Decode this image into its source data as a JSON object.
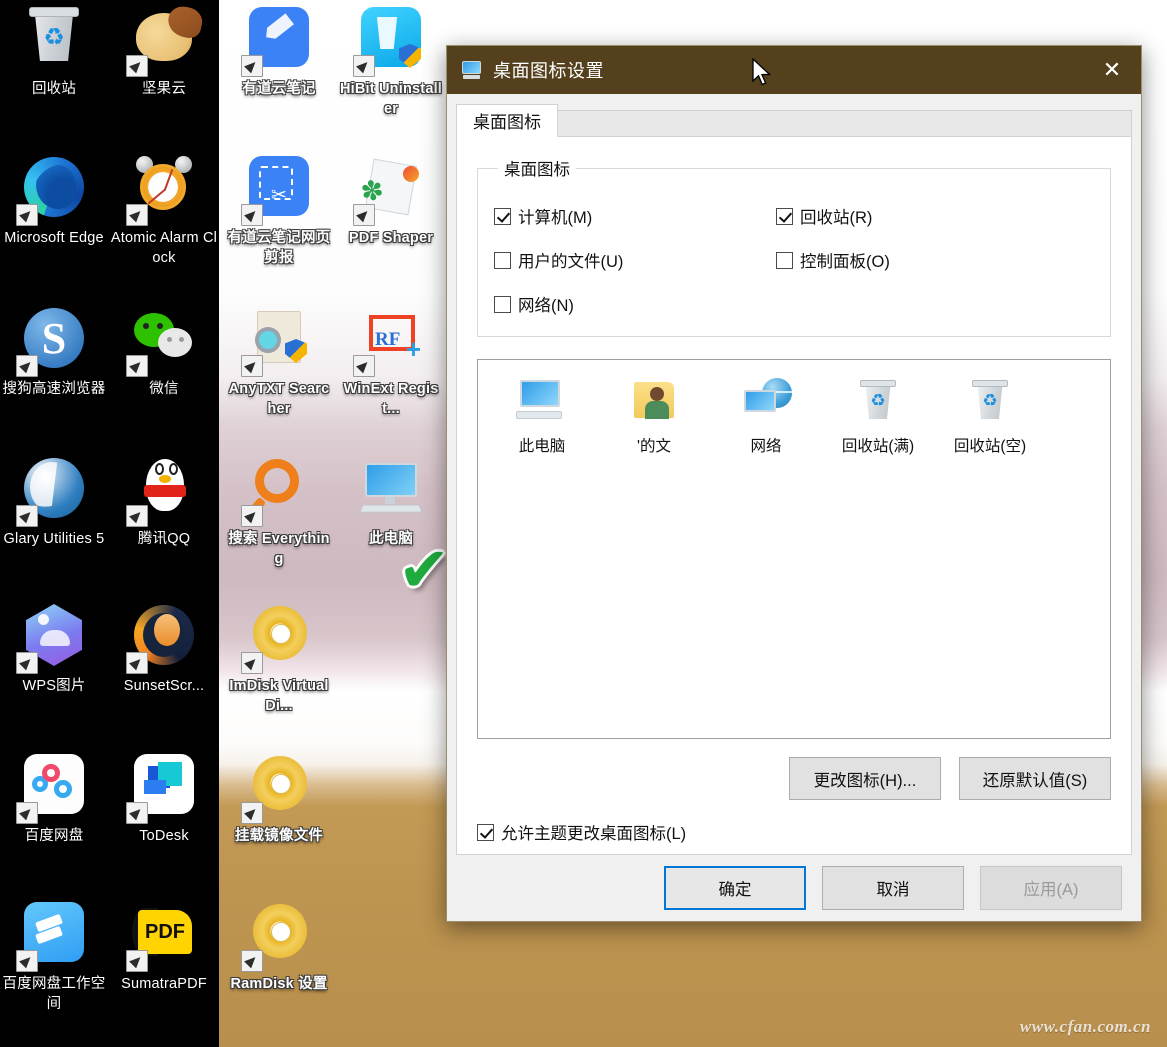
{
  "desktop": {
    "watermark": "www.cfan.com.cn",
    "icons": [
      {
        "label": "回收站",
        "art": "recycle-bin",
        "shortcut": false,
        "col": 0,
        "row": 0
      },
      {
        "label": "坚果云",
        "art": "acorn",
        "shortcut": true,
        "col": 1,
        "row": 0
      },
      {
        "label": "有道云笔记",
        "art": "note-pen",
        "shortcut": true,
        "col": 2,
        "row": 0
      },
      {
        "label": "HiBit Uninstaller",
        "art": "hibit",
        "shortcut": true,
        "col": 3,
        "row": 0
      },
      {
        "label": "Microsoft Edge",
        "art": "edge",
        "shortcut": true,
        "col": 0,
        "row": 1
      },
      {
        "label": "Atomic Alarm Clock",
        "art": "alarm-clock",
        "shortcut": true,
        "col": 1,
        "row": 1
      },
      {
        "label": "有道云笔记网页剪报",
        "art": "clip-scissors",
        "shortcut": true,
        "col": 2,
        "row": 1
      },
      {
        "label": "PDF Shaper",
        "art": "pdf-shaper",
        "shortcut": true,
        "col": 3,
        "row": 1
      },
      {
        "label": "搜狗高速浏览器",
        "art": "sogou",
        "shortcut": true,
        "col": 0,
        "row": 2
      },
      {
        "label": "微信",
        "art": "wechat",
        "shortcut": true,
        "col": 1,
        "row": 2
      },
      {
        "label": "AnyTXT Searcher",
        "art": "anytxt",
        "shortcut": true,
        "col": 2,
        "row": 2
      },
      {
        "label": "WinExt Regist...",
        "art": "winext",
        "shortcut": true,
        "col": 3,
        "row": 2
      },
      {
        "label": "Glary Utilities 5",
        "art": "glary",
        "shortcut": true,
        "col": 0,
        "row": 3
      },
      {
        "label": "腾讯QQ",
        "art": "qq",
        "shortcut": true,
        "col": 1,
        "row": 3
      },
      {
        "label": "搜索 Everything",
        "art": "everything",
        "shortcut": true,
        "col": 2,
        "row": 3
      },
      {
        "label": "此电脑",
        "art": "this-pc",
        "shortcut": false,
        "col": 3,
        "row": 3
      },
      {
        "label": "WPS图片",
        "art": "wps-photo",
        "shortcut": true,
        "col": 0,
        "row": 4
      },
      {
        "label": "SunsetScr...",
        "art": "sunset",
        "shortcut": true,
        "col": 1,
        "row": 4
      },
      {
        "label": "ImDisk Virtual Di...",
        "art": "cd-disc",
        "shortcut": true,
        "col": 2,
        "row": 4
      },
      {
        "label": "百度网盘",
        "art": "baidu-pan",
        "shortcut": true,
        "col": 0,
        "row": 5
      },
      {
        "label": "ToDesk",
        "art": "todesk",
        "shortcut": true,
        "col": 1,
        "row": 5
      },
      {
        "label": "挂载镜像文件",
        "art": "cd-disc",
        "shortcut": true,
        "col": 2,
        "row": 5
      },
      {
        "label": "百度网盘工作空间",
        "art": "baidu-workspace",
        "shortcut": true,
        "col": 0,
        "row": 6
      },
      {
        "label": "SumatraPDF",
        "art": "sumatra-pdf",
        "shortcut": true,
        "col": 1,
        "row": 6
      },
      {
        "label": "RamDisk 设置",
        "art": "cd-disc",
        "shortcut": true,
        "col": 2,
        "row": 6
      }
    ],
    "annotations": [
      {
        "name": "checkmark-computer",
        "glyph": "✔"
      },
      {
        "name": "checkmark-this-pc",
        "glyph": "✔"
      }
    ]
  },
  "dialog": {
    "title": "桌面图标设置",
    "close_label": "✕",
    "tab": {
      "label": "桌面图标"
    },
    "group": {
      "legend": "桌面图标",
      "checkboxes": [
        {
          "label": "计算机(M)",
          "checked": true
        },
        {
          "label": "回收站(R)",
          "checked": true
        },
        {
          "label": "用户的文件(U)",
          "checked": false
        },
        {
          "label": "控制面板(O)",
          "checked": false
        },
        {
          "label": "网络(N)",
          "checked": false
        }
      ]
    },
    "preview": {
      "items": [
        {
          "label": "此电脑",
          "art": "this-pc"
        },
        {
          "label": "'的文",
          "art": "user-files"
        },
        {
          "label": "网络",
          "art": "network"
        },
        {
          "label": "回收站(满)",
          "art": "recycle-full"
        },
        {
          "label": "回收站(空)",
          "art": "recycle-empty"
        }
      ]
    },
    "actions": {
      "change_icon": "更改图标(H)...",
      "restore_default": "还原默认值(S)"
    },
    "allow_theme": {
      "label": "允许主题更改桌面图标(L)",
      "checked": true
    },
    "footer": {
      "ok": "确定",
      "cancel": "取消",
      "apply": "应用(A)"
    }
  },
  "colors": {
    "titlebar": "#55401e",
    "accent_focus": "#0078d7",
    "annotation_green": "#1fab3d"
  }
}
